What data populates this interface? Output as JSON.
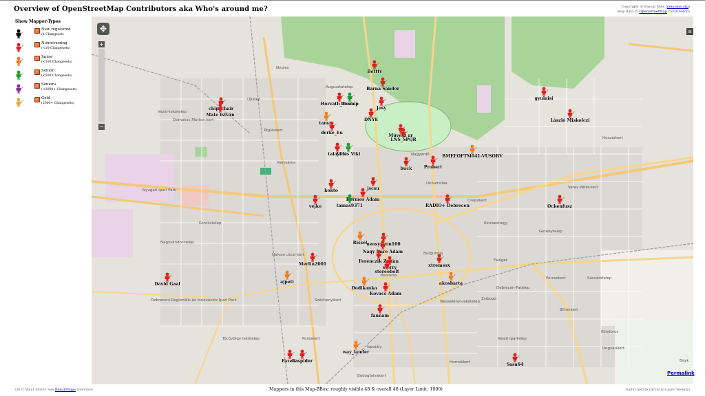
{
  "title": "Overview of OpenStreetMap Contributors aka Who's around me?",
  "copyright": {
    "line1_prefix": "Copyright © Pascal Neis (",
    "line1_link": "neis-one.org",
    "line1_suffix": ")",
    "line2_prefix": "Map data © ",
    "line2_link": "OpenStreetMap",
    "line2_suffix": " contributors"
  },
  "legend": {
    "title": "Show Mapper-Types",
    "items": [
      {
        "label": "New registered",
        "sub": "(1 Changeset)",
        "color": "#000000"
      },
      {
        "label": "Nonrecurring",
        "sub": "(<10 Changesets)",
        "color": "#e0201c"
      },
      {
        "label": "Junior",
        "sub": "(<100 Changesets)",
        "color": "#f07d22"
      },
      {
        "label": "Senior",
        "sub": "(<500 Changesets)",
        "color": "#1e9b2a"
      },
      {
        "label": "Senior+",
        "sub": "(<2000+ Changesets)",
        "color": "#8b2a9a"
      },
      {
        "label": "Gold",
        "sub": "(2000+ Changesets)",
        "color": "#e8a63a"
      }
    ]
  },
  "map_controls": {
    "pan_glyph": "✥",
    "zoom_in": "+",
    "zoom_out": "−",
    "layers_glyph": "≡"
  },
  "permalink": "Permalink",
  "footer": {
    "left_prefix": "Oh U Want More? See ",
    "left_link": "ResultMaps",
    "left_suffix": " Overview",
    "center": "Mappers in this Map-BBox: roughly visible 48 & overall 48 (Layer Limit: 1000)",
    "right": "Daily Update (Activity-Layer Weekly)"
  },
  "place_names": [
    "Nyulas",
    "Augusztatelep",
    "Vezér-lakótelep",
    "Domokos Márton-kert",
    "Újtelep",
    "Tégláskert",
    "Kertváros",
    "Nyugati Ipari Park",
    "Kontóstelep",
    "Nagysándor-telep",
    "Halvan utcai kert",
    "Debreceni Regionális és Innovációs Ipari Park",
    "Tócóvölgy lakótelep",
    "Postakert",
    "Homokkert",
    "Széchenyikert",
    "Ispotály",
    "Belváros",
    "Csapókert",
    "Kincseshegy",
    "Gerebytelep",
    "Falóger",
    "Pércsekert",
    "Sásvárstelep",
    "Bihankert",
    "Köndoros",
    "Keleti Ipartelep",
    "Veres Péter-kert",
    "Huszárkert",
    "Ungvárikert",
    "Bayk",
    "Bodogfalvakert",
    "Zsibogó",
    "Universitas",
    "Nagyerdő",
    "Wesselényi-lakótelep",
    "Burgundia",
    "Debrecen-Fatelep"
  ],
  "mappers": [
    {
      "name": "Betttv",
      "type": "nonrecurring"
    },
    {
      "name": "Barna Sándor",
      "type": "nonrecurring"
    },
    {
      "name": "Horvath_Dorina",
      "type": "nonrecurring"
    },
    {
      "name": "Dornép",
      "type": "senior"
    },
    {
      "name": "Josy",
      "type": "nonrecurring"
    },
    {
      "name": "chipschair",
      "type": "nonrecurring"
    },
    {
      "name": "Mate István",
      "type": "nonrecurring"
    },
    {
      "name": "DNYE",
      "type": "nonrecurring"
    },
    {
      "name": "tamas",
      "type": "junior"
    },
    {
      "name": "derke_hu",
      "type": "nonrecurring"
    },
    {
      "name": "Müvész ar",
      "type": "nonrecurring"
    },
    {
      "name": "LNS_SPQR",
      "type": "nonrecurring"
    },
    {
      "name": "gyulaisi",
      "type": "nonrecurring"
    },
    {
      "name": "László Miskolczi",
      "type": "nonrecurring"
    },
    {
      "name": "talajsisi",
      "type": "nonrecurring"
    },
    {
      "name": "Vides Viki",
      "type": "senior"
    },
    {
      "name": "BMEEOFTM041-VUSOBV",
      "type": "junior"
    },
    {
      "name": "buck",
      "type": "nonrecurring"
    },
    {
      "name": "Probert",
      "type": "nonrecurring"
    },
    {
      "name": "kokto",
      "type": "nonrecurring"
    },
    {
      "name": "jscsu",
      "type": "nonrecurring"
    },
    {
      "name": "Kormos Adam",
      "type": "nonrecurring"
    },
    {
      "name": "tamas9371",
      "type": "senior"
    },
    {
      "name": "vejko",
      "type": "nonrecurring"
    },
    {
      "name": "RADIO+ Debrecen",
      "type": "nonrecurring"
    },
    {
      "name": "Ockenfusz",
      "type": "nonrecurring"
    },
    {
      "name": "Rissel",
      "type": "junior"
    },
    {
      "name": "neosystem100",
      "type": "nonrecurring"
    },
    {
      "name": "Nagy Imre Adam",
      "type": "nonrecurring"
    },
    {
      "name": "Merlin2001",
      "type": "nonrecurring"
    },
    {
      "name": "Ferenczik Zoltan",
      "type": "nonrecurring"
    },
    {
      "name": "sterry",
      "type": "nonrecurring"
    },
    {
      "name": "stereobolt",
      "type": "nonrecurring"
    },
    {
      "name": "xtremesx",
      "type": "nonrecurring"
    },
    {
      "name": "ajpeti",
      "type": "junior"
    },
    {
      "name": "akosbarta",
      "type": "junior"
    },
    {
      "name": "David Gaal",
      "type": "nonrecurring"
    },
    {
      "name": "Dodikanka",
      "type": "junior"
    },
    {
      "name": "Kovacs Adam",
      "type": "nonrecurring"
    },
    {
      "name": "fannam",
      "type": "nonrecurring"
    },
    {
      "name": "way_lander",
      "type": "junior"
    },
    {
      "name": "Fazeka",
      "type": "nonrecurring"
    },
    {
      "name": "flaspider",
      "type": "nonrecurring"
    },
    {
      "name": "Sasa64",
      "type": "nonrecurring"
    }
  ],
  "colors": {
    "nonrecurring": "#e0201c",
    "junior": "#f07d22",
    "senior": "#1e9b2a",
    "forest": "#a8d49a",
    "road": "#f4c878"
  }
}
